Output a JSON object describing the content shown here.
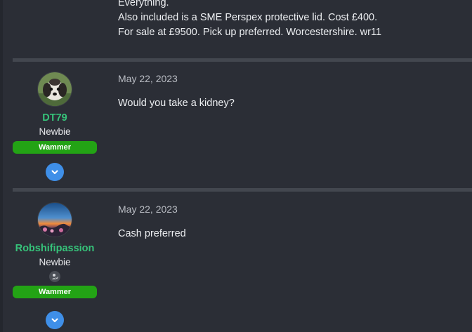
{
  "previous_post": {
    "lines": [
      "Everything.",
      "Also included is a SME Perspex protective lid. Cost £400.",
      "For sale at £9500. Pick up preferred. Worcestershire. wr11"
    ]
  },
  "posts": [
    {
      "author": {
        "name": "DT79",
        "rank": "Newbie",
        "group": "Wammer"
      },
      "date": "May 22, 2023",
      "content": "Would you take a kidney?"
    },
    {
      "author": {
        "name": "Robshifipassion",
        "rank": "Newbie",
        "group": "Wammer"
      },
      "date": "May 22, 2023",
      "content": "Cash preferred"
    }
  ],
  "colors": {
    "background": "#2b2e36",
    "username": "#36c37a",
    "group_badge": "#23a315",
    "expand_button": "#3f8fe8",
    "divider": "#43474f"
  },
  "icons": {
    "expand": "chevron-down-icon",
    "badge": "user-badge-icon"
  }
}
